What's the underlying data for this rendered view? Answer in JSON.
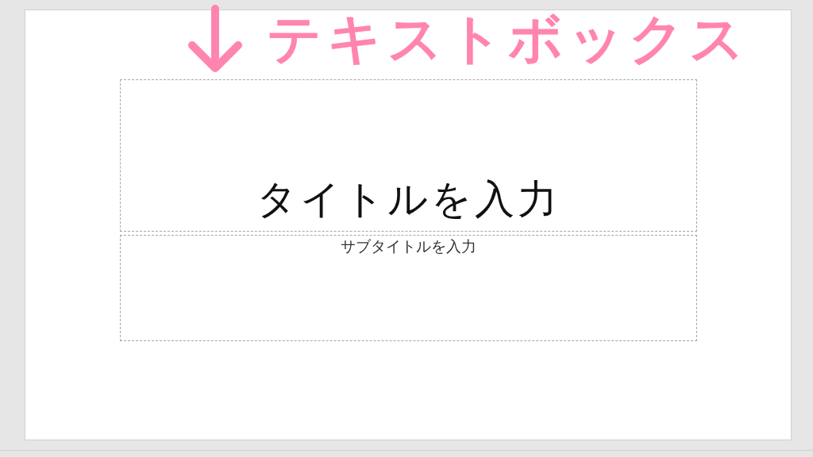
{
  "slide": {
    "title_placeholder": "タイトルを入力",
    "subtitle_placeholder": "サブタイトルを入力"
  },
  "annotation": {
    "label": "テキストボックス"
  }
}
